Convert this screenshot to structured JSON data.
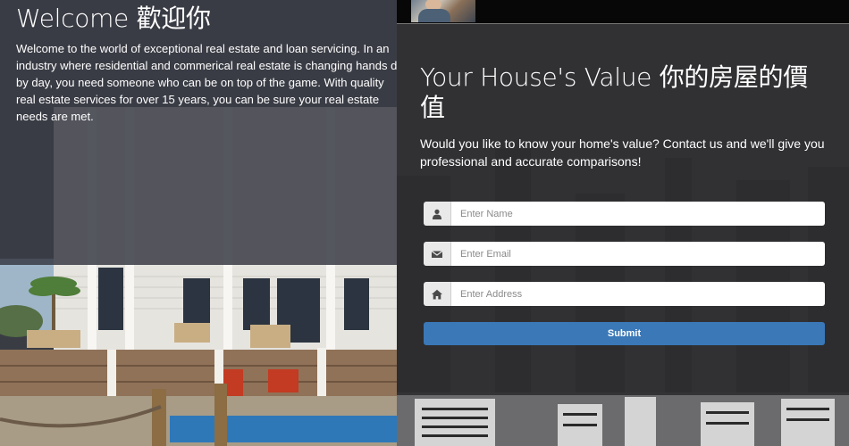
{
  "welcome": {
    "title": "Welcome 歡迎你",
    "lines": [
      "Welcome to the world of exceptional real estate and loan servicing. In an",
      "industry where residential and commerical real estate is changing hands day",
      "by day, you need someone who can be on top of the game. With quality",
      "real estate services for over 15 years, you can be sure your real estate",
      "needs are met."
    ]
  },
  "valuation": {
    "title_line1": "Your House's Value 你的房屋的價",
    "title_line2": "值",
    "description_line1": "Would you like to know your home's value? Contact us and we'll give you",
    "description_line2": "professional and accurate comparisons!",
    "form": {
      "name_placeholder": "Enter Name",
      "email_placeholder": "Enter Email",
      "address_placeholder": "Enter Address",
      "submit_label": "Submit"
    }
  },
  "icons": {
    "name": "user-icon",
    "email": "envelope-icon",
    "address": "home-icon"
  },
  "colors": {
    "submit_button": "#3a78b8",
    "panel_overlay": "#3a3c46"
  }
}
